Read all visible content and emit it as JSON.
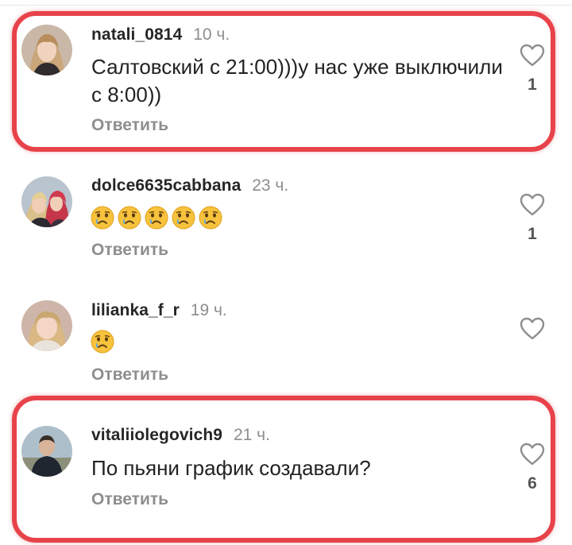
{
  "comments": [
    {
      "username": "natali_0814",
      "time": "10 ч.",
      "text": "Салтовский с 21:00)))у нас уже выключили с 8:00))",
      "reply_label": "Ответить",
      "likes": "1",
      "highlighted": true,
      "avatar": "woman-blonde-avatar"
    },
    {
      "username": "dolce6635cabbana",
      "time": "23 ч.",
      "emoji_count": 5,
      "emoji": "crying-face",
      "reply_label": "Ответить",
      "likes": "1",
      "highlighted": false,
      "avatar": "two-women-avatar"
    },
    {
      "username": "lilianka_f_r",
      "time": "19 ч.",
      "emoji_count": 1,
      "emoji": "crying-face",
      "reply_label": "Ответить",
      "likes": "",
      "highlighted": false,
      "avatar": "woman-avatar"
    },
    {
      "username": "vitaliiolegovich9",
      "time": "21 ч.",
      "text": "По пьяни график создавали?",
      "reply_label": "Ответить",
      "likes": "6",
      "highlighted": true,
      "avatar": "man-avatar"
    }
  ],
  "icons": {
    "like": "heart-outline-icon"
  },
  "colors": {
    "highlight": "#e8424a",
    "secondary_text": "#8e8e8e"
  }
}
